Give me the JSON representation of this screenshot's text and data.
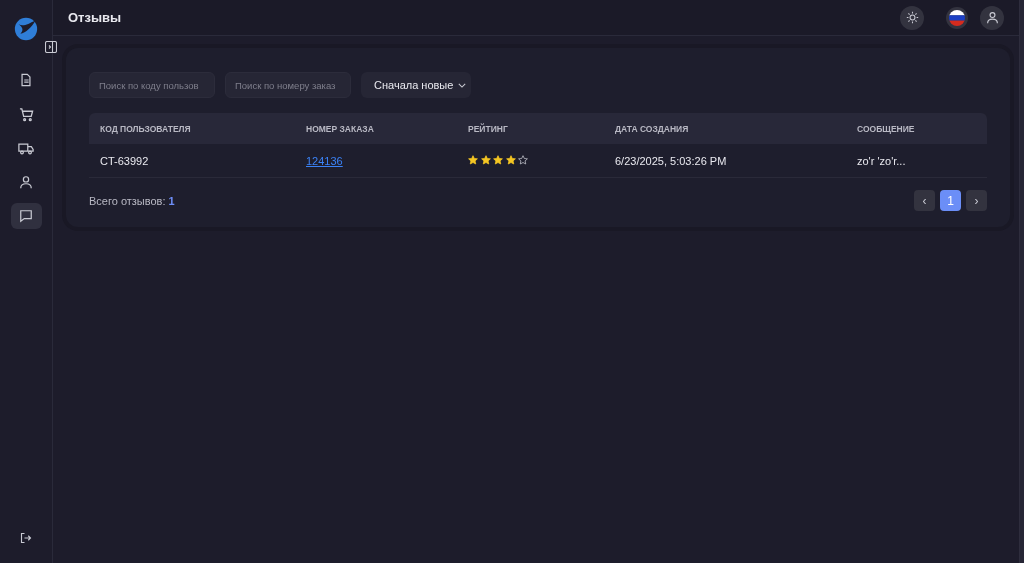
{
  "header": {
    "title": "Отзывы"
  },
  "sidebar": {
    "items": [
      {
        "kind": "document",
        "selected": false
      },
      {
        "kind": "cart",
        "selected": false
      },
      {
        "kind": "truck",
        "selected": false
      },
      {
        "kind": "user",
        "selected": false
      },
      {
        "kind": "chat",
        "selected": true
      }
    ]
  },
  "filters": {
    "user_search": {
      "placeholder": "Поиск по коду пользов"
    },
    "order_search": {
      "placeholder": "Поиск по номеру заказ"
    },
    "sort": {
      "value": "Сначала новые"
    }
  },
  "table": {
    "columns": [
      "КОД ПОЛЬЗОВАТЕЛЯ",
      "НОМЕР ЗАКАЗА",
      "РЕЙТИНГ",
      "ДАТА СОЗДАНИЯ",
      "СООБЩЕНИЕ"
    ],
    "rows": [
      {
        "user_code": "CT-63992",
        "order_number": "124136",
        "stars": 4,
        "created": "6/23/2025, 5:03:26 PM",
        "message": "zo'r 'zo'r..."
      }
    ]
  },
  "total": {
    "label": "Всего отзывов:",
    "value": "1"
  },
  "pagination": {
    "prev": "‹",
    "pages": [
      {
        "label": "1",
        "selected": true
      }
    ],
    "next": "›"
  }
}
